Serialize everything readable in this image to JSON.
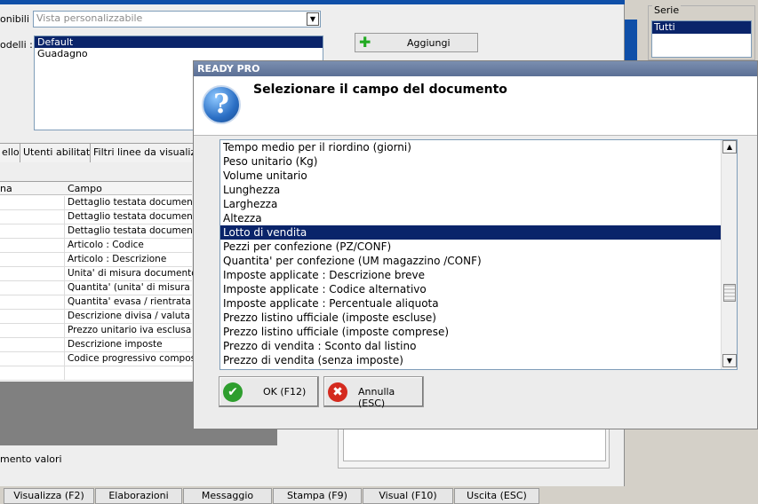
{
  "background": {
    "available_label": "onibili :",
    "available_value": "Vista personalizzabile",
    "models_label": "odelli :",
    "models": [
      "Default",
      "Guadagno"
    ],
    "add_button": "Aggiungi",
    "tabs": [
      "ello",
      "Utenti abilitati",
      "Filtri linee da visualizzar"
    ],
    "grid_headers": [
      "na",
      "Campo"
    ],
    "grid_rows": [
      "Dettaglio testata documento",
      "Dettaglio testata documento",
      "Dettaglio testata documento",
      "Articolo : Codice",
      "Articolo : Descrizione",
      "Unita' di misura documento",
      "Quantita' (unita' di misura doc",
      "Quantita' evasa / rientrata",
      "Descrizione divisa / valuta",
      "Prezzo unitario iva esclusa",
      "Descrizione imposte",
      "Codice progressivo composizi"
    ],
    "bottom_label": "mento valori",
    "serie_title": "Serie",
    "serie_items": [
      "Tutti"
    ],
    "bottom_buttons": [
      "Visualizza (F2)",
      "Elaborazioni",
      "Messaggio",
      "Stampa (F9)",
      "Visual (F10)",
      "Uscita (ESC)"
    ]
  },
  "dialog": {
    "title": "READY PRO",
    "heading": "Selezionare il campo del documento",
    "items": [
      "Tempo medio per il riordino (giorni)",
      "Peso unitario (Kg)",
      "Volume unitario",
      "Lunghezza",
      "Larghezza",
      "Altezza",
      "Lotto di vendita",
      "Pezzi per confezione (PZ/CONF)",
      "Quantita' per confezione (UM magazzino /CONF)",
      "Imposte applicate : Descrizione breve",
      "Imposte applicate : Codice alternativo",
      "Imposte applicate : Percentuale aliquota",
      "Prezzo listino ufficiale (imposte escluse)",
      "Prezzo listino ufficiale (imposte comprese)",
      "Prezzo di vendita : Sconto dal listino",
      "Prezzo di vendita (senza imposte)"
    ],
    "selected_index": 6,
    "ok_label": "OK (F12)",
    "cancel_label": "Annulla (ESC)"
  },
  "colors": {
    "selection": "#0a246a",
    "ok_icon": "#2e9e2e",
    "cancel_icon": "#d42a1e"
  }
}
